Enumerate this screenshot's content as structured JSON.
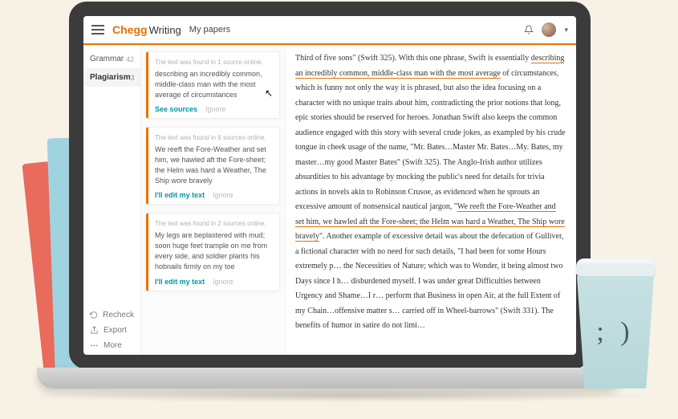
{
  "header": {
    "brand1": "Chegg",
    "brand2": "Writing",
    "page_title": "My papers"
  },
  "sidebar": {
    "items": [
      {
        "label": "Grammar",
        "count": "42"
      },
      {
        "label": "Plagiarism",
        "count": "3"
      }
    ],
    "bottom": {
      "recheck": "Recheck",
      "export": "Export",
      "more": "More"
    }
  },
  "cards": [
    {
      "source_note": "The text was found in 1 source online.",
      "excerpt": "describing an incredibly common, middle-class man with the most average of circumstances",
      "primary_action": "See sources",
      "ignore": "Ignore"
    },
    {
      "source_note": "The text was found in 6 sources online.",
      "excerpt": "We reeft the Fore-Weather and  set him, we hawled aft the Fore-sheet; the Helm was hard a Weather, The Ship wore bravely",
      "primary_action": "I'll edit my text",
      "ignore": "Ignore"
    },
    {
      "source_note": "The text was found in 2 sources online.",
      "excerpt": "My legs are beplastered with mud; soon huge feet trample on me from every side, and soldier plants his hobnails firmly on my toe",
      "primary_action": "I'll edit my text",
      "ignore": "Ignore"
    }
  ],
  "essay": {
    "p1a": "Third of five sons\" (Swift 325). With this one phrase, Swift is essentially ",
    "hl1": "describing an incredibly common, middle-class man with the most average",
    "p1b": " of circumstances, which is funny not only the way it is phrased, but also the idea focusing on a character with no unique traits about him, contradicting the prior notions that long, epic stories should be reserved for heroes. Jonathan Swift also keeps the common audience engaged with this story with several crude jokes, as exampled by his crude tongue in cheek usage of the name, \"Mr. Bates…Master Mr. Bates…My. Bates, my master…my good Master Bates\" (Swift 325). The Anglo-Irish author utilizes absurdities to his advantage by mocking the public's need for details for trivia actions in novels akin to Robinson Crusoe, as evidenced when he sprouts an excessive amount of nonsensical nautical jargon, \"",
    "hl2": "We reeft the Fore-Weather and  set him, we hawled aft the Fore-sheet; the Helm was hard a Weather, The Ship wore bravely",
    "p1c": "\". Another example of excessive detail was about the defecation of Gulliver, a fictional character with no need for such details, \"I had been for some Hours extremely p… the Necessities of Nature; which was to Wonder, it being almost two Days since I h… disburdened myself. I was under great Difficulties between Urgency and Shame…I r… perform that Business in open Air, at the full Extent of my Chain…offensive matter s… carried off in Wheel-barrows\" (Swift 331). The benefits of humor in satire do not limi…"
  },
  "cup_face": "; )"
}
